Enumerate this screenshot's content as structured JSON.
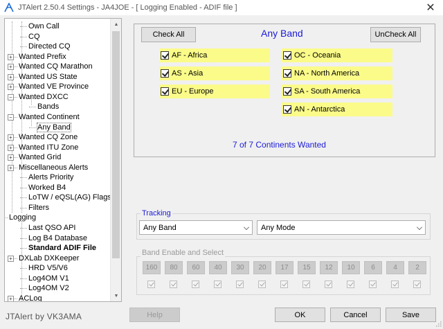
{
  "window": {
    "title": "JTAlert 2.50.4 Settings  -  JA4JOE  -  [ Logging Enabled - ADIF file ]",
    "close_glyph": "✕"
  },
  "tree": {
    "items": [
      {
        "label": "Own Call"
      },
      {
        "label": "CQ"
      },
      {
        "label": "Directed CQ"
      },
      {
        "label": "Wanted Prefix",
        "expander": "+"
      },
      {
        "label": "Wanted CQ Marathon",
        "expander": "+"
      },
      {
        "label": "Wanted US State",
        "expander": "+"
      },
      {
        "label": "Wanted VE Province",
        "expander": "+"
      },
      {
        "label": "Wanted DXCC",
        "expander": "−"
      },
      {
        "label": "Bands"
      },
      {
        "label": "Wanted Continent",
        "expander": "−"
      },
      {
        "label": "Any Band"
      },
      {
        "label": "Wanted CQ Zone",
        "expander": "+"
      },
      {
        "label": "Wanted ITU Zone",
        "expander": "+"
      },
      {
        "label": "Wanted Grid",
        "expander": "+"
      },
      {
        "label": "Miscellaneous Alerts",
        "expander": "+"
      },
      {
        "label": "Alerts Priority"
      },
      {
        "label": "Worked B4"
      },
      {
        "label": "LoTW / eQSL(AG) Flags"
      },
      {
        "label": "Filters"
      },
      {
        "label": "Logging",
        "expander": "−"
      },
      {
        "label": "Last QSO API"
      },
      {
        "label": "Log B4 Database"
      },
      {
        "label": "Standard ADIF File"
      },
      {
        "label": "DXLab DXKeeper",
        "expander": "+"
      },
      {
        "label": "HRD V5/V6"
      },
      {
        "label": "Log4OM V1"
      },
      {
        "label": "Log4OM V2"
      },
      {
        "label": "ACLog",
        "expander": "+"
      }
    ]
  },
  "panel": {
    "title": "Any Band",
    "check_all_label": "Check All",
    "uncheck_all_label": "UnCheck All",
    "continents_left": [
      {
        "label": "AF - Africa",
        "checked": true
      },
      {
        "label": "AS - Asia",
        "checked": true
      },
      {
        "label": "EU - Europe",
        "checked": true
      }
    ],
    "continents_right": [
      {
        "label": "OC - Oceania",
        "checked": true
      },
      {
        "label": "NA - North America",
        "checked": true
      },
      {
        "label": "SA - South America",
        "checked": true
      },
      {
        "label": "AN - Antarctica",
        "checked": true
      }
    ],
    "summary": "7 of 7 Continents Wanted",
    "title_color": "#1a1ad6",
    "highlight_color": "#fbfb8a"
  },
  "tracking": {
    "label": "Tracking",
    "band_value": "Any Band",
    "mode_value": "Any Mode"
  },
  "band_enable": {
    "label": "Band Enable and Select",
    "bands": [
      "160",
      "80",
      "60",
      "40",
      "30",
      "20",
      "17",
      "15",
      "12",
      "10",
      "6",
      "4",
      "2"
    ]
  },
  "footer": {
    "brand": "JTAlert by VK3AMA",
    "help_label": "Help",
    "ok_label": "OK",
    "cancel_label": "Cancel",
    "save_label": "Save"
  }
}
